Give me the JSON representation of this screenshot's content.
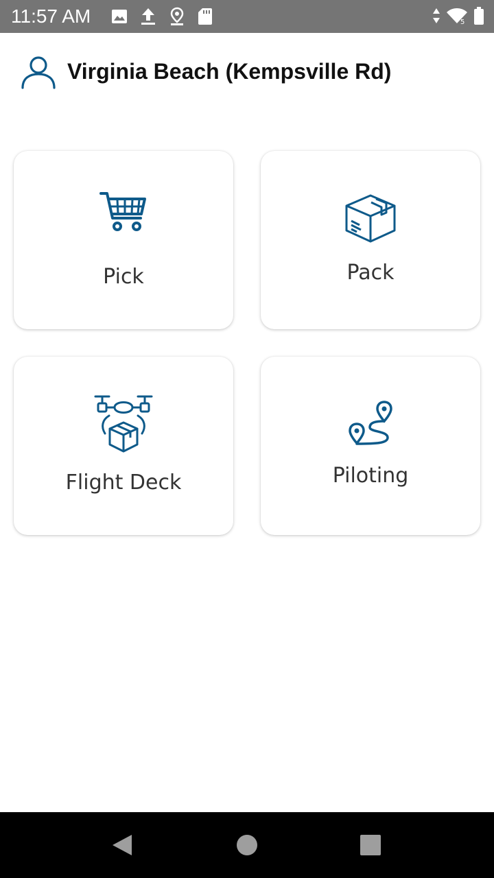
{
  "status_bar": {
    "time": "11:57 AM",
    "icons_left": [
      "image-icon",
      "upload-icon",
      "location-pin-icon",
      "sd-card-icon"
    ],
    "icons_right": [
      "data-arrows-icon",
      "wifi-icon",
      "battery-icon"
    ]
  },
  "header": {
    "icon": "user-icon",
    "location": "Virginia Beach (Kempsville Rd)"
  },
  "tiles": [
    {
      "label": "Pick",
      "icon": "shopping-cart-icon"
    },
    {
      "label": "Pack",
      "icon": "package-box-icon"
    },
    {
      "label": "Flight Deck",
      "icon": "drone-delivery-icon"
    },
    {
      "label": "Piloting",
      "icon": "route-icon"
    }
  ],
  "nav_bar": {
    "icons": [
      "back-icon",
      "home-icon",
      "recent-apps-icon"
    ]
  },
  "colors": {
    "accent": "#0E5A8A",
    "status_bar": "#757575",
    "nav_bar": "#000000"
  }
}
